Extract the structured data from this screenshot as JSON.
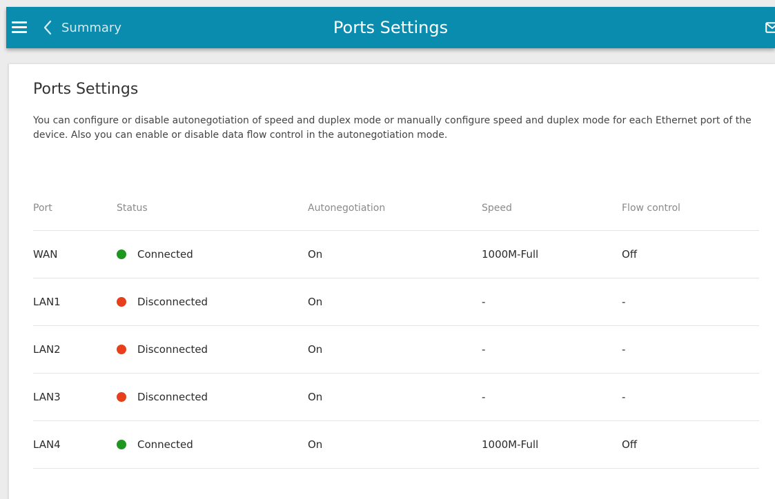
{
  "header": {
    "back_label": "Summary",
    "title": "Ports Settings",
    "menu_icon": "hamburger-icon",
    "back_icon": "chevron-left-icon",
    "mail_icon": "mail-icon",
    "bar_color": "#0a8cae"
  },
  "content": {
    "section_title": "Ports Settings",
    "description": "You can configure or disable autonegotiation of speed and duplex mode or manually configure speed and duplex mode for each Ethernet port of the device. Also you can enable or disable data flow control in the autonegotiation mode."
  },
  "table": {
    "headers": {
      "port": "Port",
      "status": "Status",
      "autonegotiation": "Autonegotiation",
      "speed": "Speed",
      "flow_control": "Flow control"
    },
    "rows": [
      {
        "port": "WAN",
        "status": "Connected",
        "status_color": "#1f961f",
        "autonegotiation": "On",
        "speed": "1000M-Full",
        "flow_control": "Off"
      },
      {
        "port": "LAN1",
        "status": "Disconnected",
        "status_color": "#e73f1c",
        "autonegotiation": "On",
        "speed": "-",
        "flow_control": "-"
      },
      {
        "port": "LAN2",
        "status": "Disconnected",
        "status_color": "#e73f1c",
        "autonegotiation": "On",
        "speed": "-",
        "flow_control": "-"
      },
      {
        "port": "LAN3",
        "status": "Disconnected",
        "status_color": "#e73f1c",
        "autonegotiation": "On",
        "speed": "-",
        "flow_control": "-"
      },
      {
        "port": "LAN4",
        "status": "Connected",
        "status_color": "#1f961f",
        "autonegotiation": "On",
        "speed": "1000M-Full",
        "flow_control": "Off"
      }
    ]
  }
}
